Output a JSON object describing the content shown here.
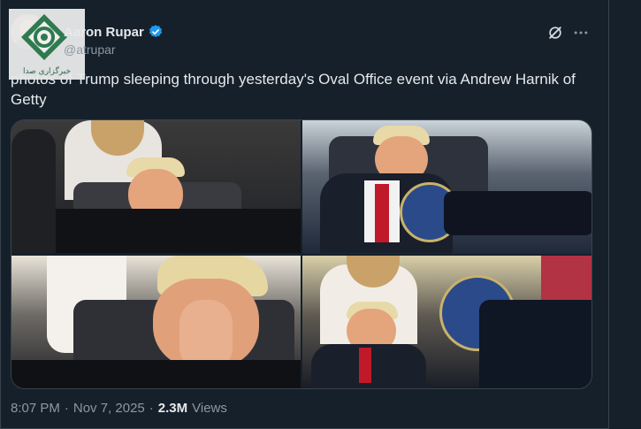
{
  "author": {
    "display_name": "Aaron Rupar",
    "handle": "@atrupar",
    "verified": true
  },
  "header_actions": {
    "grok_icon": "grok-icon",
    "more_icon": "more-horizontal-icon"
  },
  "watermark": {
    "text": "خبرگزاری صدا"
  },
  "tweet": {
    "text": "photos of Trump sleeping through yesterday's Oval Office event via Andrew Harnik of Getty"
  },
  "media": {
    "count": 4
  },
  "meta": {
    "time": "8:07 PM",
    "separator1": "·",
    "date": "Nov 7, 2025",
    "separator2": "·",
    "views_count": "2.3M",
    "views_label": "Views"
  },
  "colors": {
    "background": "#15202b",
    "verified_blue": "#1d9bf0",
    "secondary_text": "#8b98a5",
    "primary_text": "#e7e9ea"
  }
}
